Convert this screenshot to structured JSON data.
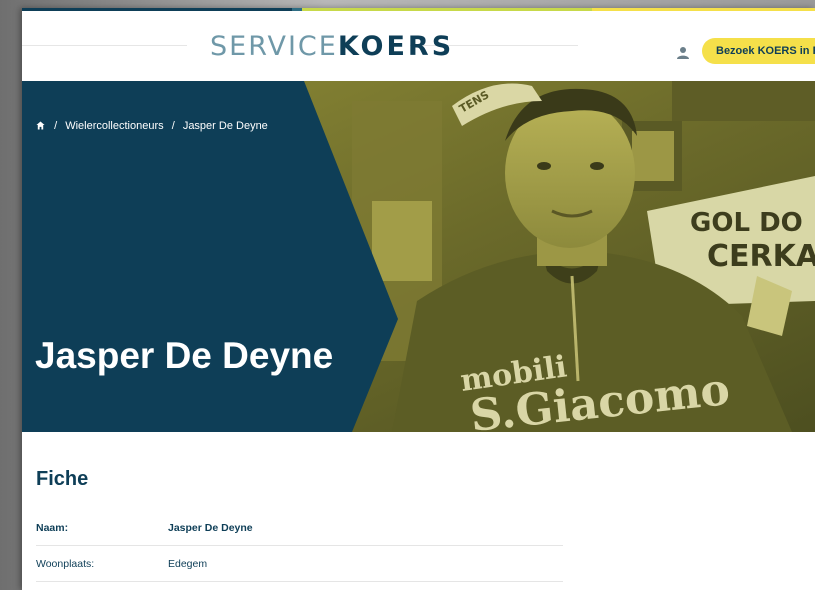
{
  "colors": {
    "navy": "#0e3e57",
    "accent_yellow": "#f5e04a",
    "strip": [
      "#0e3e57",
      "#2f6d83",
      "#c7d94a",
      "#f5e04a"
    ]
  },
  "header": {
    "logo_part1": "SERVICE",
    "logo_part2": "KOERS",
    "user_icon": "user-icon",
    "visit_button": "Bezoek KOERS in Ro"
  },
  "hero": {
    "breadcrumb": {
      "home_icon": "home-icon",
      "sep1": "/",
      "crumb1": "Wielercollectioneurs",
      "sep2": "/",
      "crumb2": "Jasper De Deyne"
    },
    "title": "Jasper De Deyne",
    "photo_texts": {
      "banner_line1": "GOL DO",
      "banner_line2": "CERKA",
      "jersey_line1": "mobili",
      "jersey_line2": "S.Giacomo",
      "cap_text": "TENS"
    }
  },
  "fiche": {
    "title": "Fiche",
    "rows": [
      {
        "label": "Naam:",
        "value": "Jasper De Deyne"
      },
      {
        "label": "Woonplaats:",
        "value": "Edegem"
      }
    ]
  }
}
